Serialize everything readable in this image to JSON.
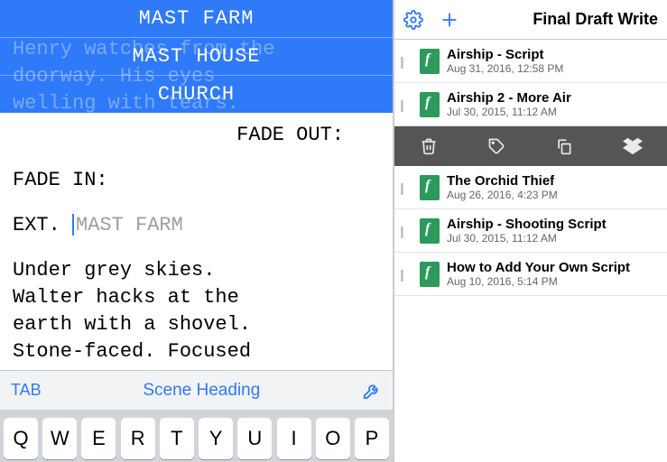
{
  "suggestions": [
    "MAST FARM",
    "MAST HOUSE",
    "CHURCH"
  ],
  "ghost": "Henry watches from the\ndoorway. His eyes\nwelling with tears.",
  "editor": {
    "fade_out": "FADE OUT:",
    "fade_in": "FADE IN:",
    "scene_prefix": "EXT. ",
    "scene_hint": "MAST FARM",
    "action": "Under grey skies.\nWalter hacks at the\nearth with a shovel.\nStone-faced. Focused"
  },
  "format_bar": {
    "tab": "TAB",
    "element": "Scene Heading"
  },
  "keyboard": [
    "Q",
    "W",
    "E",
    "R",
    "T",
    "Y",
    "U",
    "I",
    "O",
    "P"
  ],
  "right": {
    "title": "Final Draft Write",
    "files": [
      {
        "name": "Airship - Script",
        "date": "Aug 31, 2016, 12:58 PM"
      },
      {
        "name": "Airship 2 - More Air",
        "date": "Jul 30, 2015, 11:12 AM"
      },
      {
        "name": "The Orchid Thief",
        "date": "Aug 26, 2016, 4:23 PM"
      },
      {
        "name": "Airship - Shooting Script",
        "date": "Jul 30, 2015, 11:12 AM"
      },
      {
        "name": "How to Add Your Own Script",
        "date": "Aug 10, 2016, 5:14 PM"
      }
    ]
  }
}
